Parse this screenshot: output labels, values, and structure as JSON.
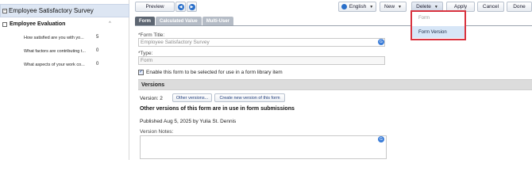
{
  "tree": {
    "root_label": "Employee Satisfactory Survey",
    "section_label": "Employee Evaluation",
    "questions": [
      {
        "text": "How satisfied are you with yo...",
        "count": "5"
      },
      {
        "text": "What factors are contributing t...",
        "count": "0"
      },
      {
        "text": "What aspects of your work co...",
        "count": "0"
      }
    ]
  },
  "toolbar": {
    "preview": "Preview",
    "language": "English",
    "new": "New",
    "delete": "Delete",
    "apply": "Apply",
    "cancel": "Cancel",
    "done": "Done"
  },
  "delete_menu": {
    "items": [
      {
        "label": "Form",
        "disabled": true
      },
      {
        "label": "Form Version",
        "disabled": false
      }
    ]
  },
  "tabs": [
    "Form",
    "Calculated Value",
    "Multi-User"
  ],
  "form": {
    "title_label": "*Form Title:",
    "title_value": "Employee Satisfactory Survey",
    "type_label": "*Type:",
    "type_value": "Form",
    "enable_label": "Enable this form to be selected for use in a form library item",
    "enable_checked": true
  },
  "versions": {
    "header": "Versions",
    "version_text": "Version: 2",
    "other_versions_btn": "Other versions...",
    "create_btn": "Create new version of this form",
    "in_use_text": "Other versions of this form are in use in form submissions",
    "published_text": "Published Aug 5, 2025 by Yulia St. Dennis",
    "notes_label": "Version Notes:"
  },
  "colors": {
    "accent": "#2a6fc9",
    "highlight_border": "#d9333f",
    "tab_active": "#5d6672",
    "tree_selected_bg": "#dde6f3"
  }
}
